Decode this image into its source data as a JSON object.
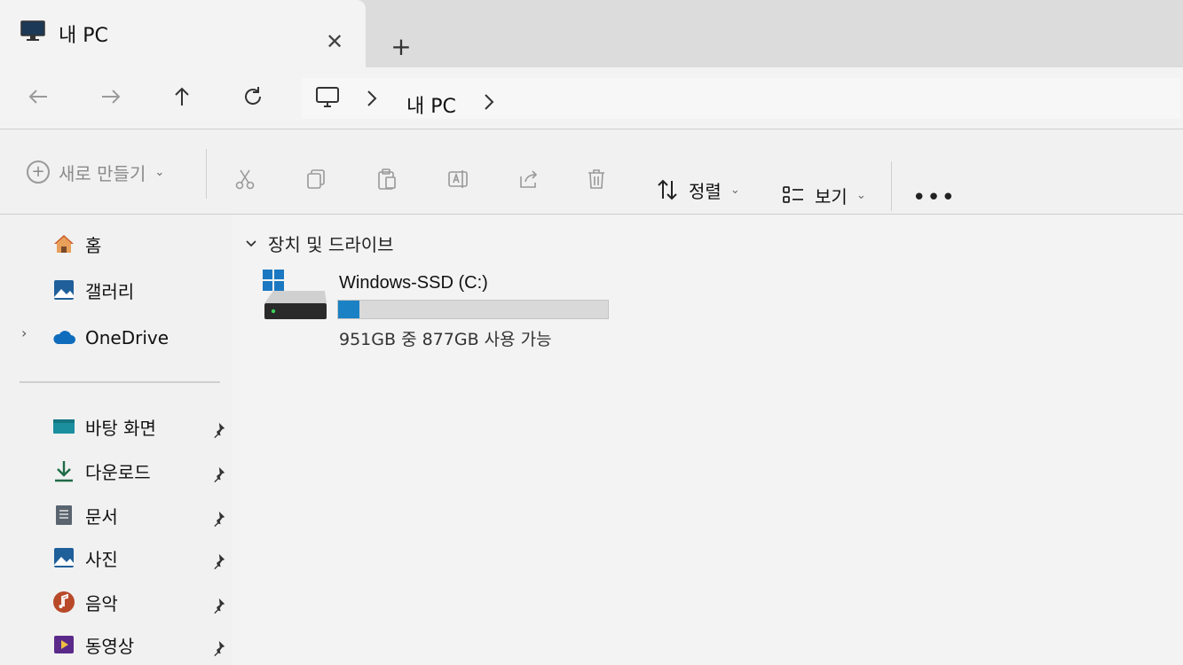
{
  "tab": {
    "title": "내 PC",
    "close_label": "✕",
    "new_tab_label": "+"
  },
  "address": {
    "crumbs": [
      "내 PC"
    ]
  },
  "command_bar": {
    "new_label": "새로 만들기",
    "sort_label": "정렬",
    "view_label": "보기",
    "more_label": "•••"
  },
  "sidebar": {
    "items": [
      {
        "label": "홈",
        "icon": "home-icon"
      },
      {
        "label": "갤러리",
        "icon": "gallery-icon"
      },
      {
        "label": "OneDrive",
        "icon": "cloud-icon"
      }
    ],
    "pinned": [
      {
        "label": "바탕 화면",
        "icon": "desktop-icon"
      },
      {
        "label": "다운로드",
        "icon": "download-icon"
      },
      {
        "label": "문서",
        "icon": "document-icon"
      },
      {
        "label": "사진",
        "icon": "pictures-icon"
      },
      {
        "label": "음악",
        "icon": "music-icon"
      },
      {
        "label": "동영상",
        "icon": "video-icon"
      }
    ]
  },
  "content": {
    "group_title": "장치 및 드라이브",
    "drives": [
      {
        "name": "Windows-SSD (C:)",
        "info": "951GB 중 877GB 사용 가능",
        "used_fraction": 0.078
      }
    ]
  },
  "colors": {
    "accent": "#1a82c4",
    "onedrive": "#0f6cbd"
  }
}
